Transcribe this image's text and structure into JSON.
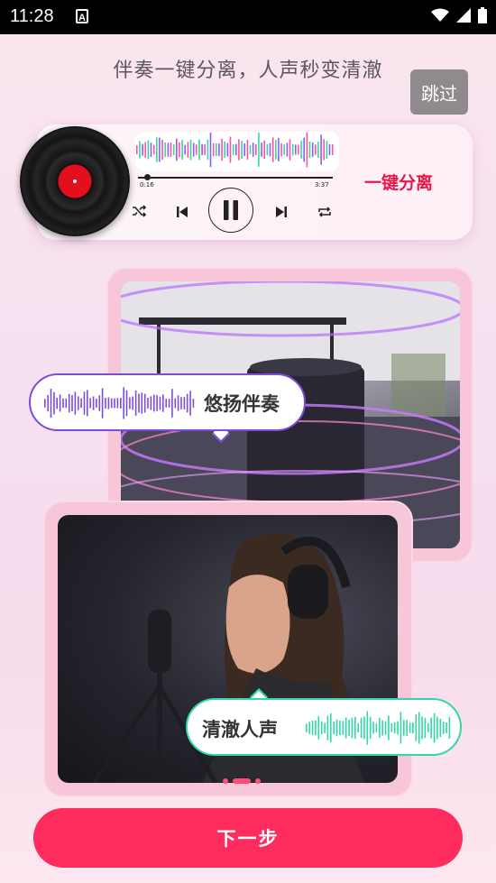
{
  "status_bar": {
    "time": "11:28",
    "app_icon": "A"
  },
  "header": {
    "title": "伴奏一键分离，人声秒变清澈",
    "skip_label": "跳过"
  },
  "player": {
    "time_current": "0:16",
    "time_total": "3:37",
    "progress": 0.05,
    "split_label": "一键分离",
    "icons": [
      "shuffle-icon",
      "previous-icon",
      "pause-icon",
      "next-icon",
      "repeat-icon"
    ]
  },
  "cards": {
    "accompaniment_label": "悠扬伴奏",
    "vocal_label": "清澈人声"
  },
  "pagination": {
    "total": 3,
    "active": 1
  },
  "footer": {
    "next_label": "下一步"
  },
  "colors": {
    "accent": "#ff2c5e",
    "purple": "#7c4ddb",
    "green": "#2fd8a4",
    "red_text": "#e8194a"
  }
}
